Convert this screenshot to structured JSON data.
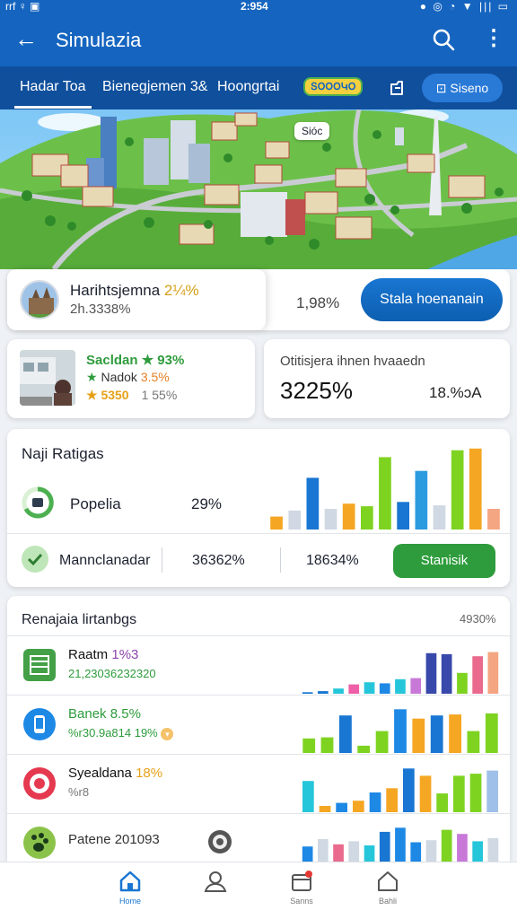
{
  "statusbar": {
    "left": "rrf ♀ ▣",
    "time": "2:954",
    "right": "● ◎ ◔ ▼ ||| ▭"
  },
  "appbar": {
    "title": "Simulazia"
  },
  "tabs": [
    {
      "label": "Hadar Toa",
      "active": true
    },
    {
      "label": "Bienegjemen 3&",
      "active": false
    },
    {
      "label": "Hoongrtai",
      "active": false
    }
  ],
  "tab_badge": "ՏՕՕՕԿՕ",
  "tab_button": "Siseno",
  "hero": {
    "map_label": "Sióc"
  },
  "card_summary": {
    "title": "Harihtsjemna",
    "title_highlight": "2¼%",
    "subtitle": "2h.3338%",
    "percent": "1,98%",
    "button": "Stala hoenanain"
  },
  "card_station": {
    "line1": "Sacldan ★ 93%",
    "line2_star": "★",
    "line2_text": "Nadok",
    "line2_pct": "3.5%",
    "line3": "★ 5350",
    "line3_gray": "1 55%"
  },
  "card_stat": {
    "label": "Otitisjera ihnen hvaaedn",
    "big": "3225%",
    "small": "18.%ɔA"
  },
  "card_ratings": {
    "title": "Naji Ratigas",
    "row1_label": "Popelia",
    "row1_pct": "29%",
    "row2_label": "Mannclanadar",
    "row2_v1": "36362%",
    "row2_v2": "18634%",
    "button": "Stanisik"
  },
  "chart_data": [
    {
      "type": "bar",
      "values": [
        15,
        22,
        60,
        24,
        30,
        27,
        84,
        32,
        68,
        28,
        92,
        94,
        24
      ],
      "colors": [
        "#f5a623",
        "#cfd8e3",
        "#1976d2",
        "#cfd8e3",
        "#f5a623",
        "#7ed321",
        "#7ed321",
        "#1976d2",
        "#2b9be0",
        "#cfd8e3",
        "#7ed321",
        "#f5a623",
        "#f4a582"
      ],
      "ylim": [
        0,
        100
      ]
    },
    {
      "type": "bar",
      "values": [
        3,
        5,
        10,
        18,
        22,
        20,
        28,
        30,
        78,
        76,
        40,
        72,
        80
      ],
      "colors": [
        "#1976d2",
        "#1976d2",
        "#26c6da",
        "#ef5fa7",
        "#26c6da",
        "#1e88e5",
        "#26c6da",
        "#c879d8",
        "#3949ab",
        "#3949ab",
        "#7ed321",
        "#e96a8d",
        "#f4a582"
      ],
      "ylim": [
        0,
        100
      ]
    },
    {
      "type": "bar",
      "values": [
        28,
        30,
        72,
        14,
        42,
        84,
        66,
        72,
        74,
        42,
        76
      ],
      "colors": [
        "#7ed321",
        "#7ed321",
        "#1976d2",
        "#7ed321",
        "#7ed321",
        "#1e88e5",
        "#f5a623",
        "#1976d2",
        "#f5a623",
        "#7ed321",
        "#7ed321"
      ],
      "ylim": [
        0,
        100
      ]
    },
    {
      "type": "bar",
      "values": [
        60,
        12,
        18,
        22,
        38,
        46,
        84,
        70,
        36,
        70,
        74,
        80
      ],
      "colors": [
        "#26c6da",
        "#f5a623",
        "#1e88e5",
        "#f5a623",
        "#1e88e5",
        "#f5a623",
        "#1976d2",
        "#f5a623",
        "#7ed321",
        "#7ed321",
        "#7ed321",
        "#9fc0e8"
      ],
      "ylim": [
        0,
        100
      ]
    },
    {
      "type": "bar",
      "values": [
        48,
        62,
        52,
        58,
        50,
        76,
        84,
        56,
        60,
        80,
        72,
        58,
        64
      ],
      "colors": [
        "#1e88e5",
        "#cfd8e3",
        "#e96a8d",
        "#cfd8e3",
        "#26c6da",
        "#1976d2",
        "#1e88e5",
        "#1e88e5",
        "#cfd8e3",
        "#7ed321",
        "#c879d8",
        "#26c6da",
        "#cfd8e3"
      ],
      "ylim": [
        0,
        100
      ]
    }
  ],
  "card_list": {
    "title": "Renajaia lirtanbgs",
    "right": "4930%",
    "rows": [
      {
        "t1": "Raatm",
        "t1_hl": "1%3",
        "t2": "21,23036232320",
        "icon": "sheet-icon",
        "t1_color": "#111",
        "hl_color": "#8e44ad",
        "t2_color": "#2e9c3c"
      },
      {
        "t1": "Banek",
        "t1_hl": "8.5%",
        "t2": "%r30.9a814 19%",
        "icon": "phone-icon",
        "t1_color": "#2e9c3c",
        "hl_color": "#2e9c3c",
        "t2_color": "#2e9c3c"
      },
      {
        "t1": "Syealdana",
        "t1_hl": "18%",
        "t2": "%r8",
        "icon": "target-icon",
        "t1_color": "#111",
        "hl_color": "#e6a117",
        "t2_color": "#777"
      },
      {
        "t1": "Patene",
        "t1_hl": "201093",
        "t2": "",
        "icon": "paw-icon",
        "t1_color": "#333",
        "hl_color": "#333",
        "t2_color": "#777"
      }
    ]
  },
  "bottom_nav": [
    {
      "label": "Home",
      "icon": "home-icon",
      "active": true
    },
    {
      "label": "",
      "icon": "profile-icon",
      "active": false
    },
    {
      "label": "Sanns",
      "icon": "inbox-icon",
      "active": false
    },
    {
      "label": "Bahli",
      "icon": "house-outline-icon",
      "active": false
    }
  ],
  "colors": {
    "primary": "#1565c0",
    "accent_green": "#2e9c3c",
    "accent_yellow": "#d4a017"
  }
}
